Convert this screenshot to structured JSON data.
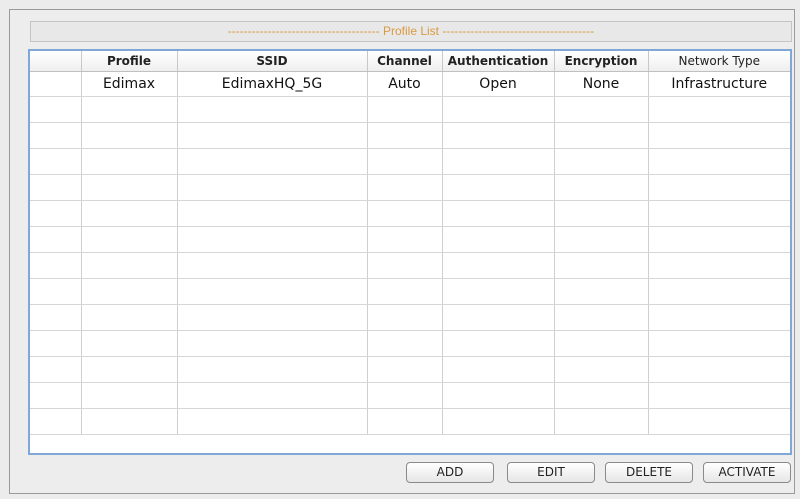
{
  "panel": {
    "title": "Profile List",
    "title_left_dashes": "--------------------------------------",
    "title_right_dashes": "--------------------------------------"
  },
  "table": {
    "columns": [
      "",
      "Profile",
      "SSID",
      "Channel",
      "Authentication",
      "Encryption",
      "Network Type"
    ],
    "rows": [
      [
        "",
        "Edimax",
        "EdimaxHQ_5G",
        "Auto",
        "Open",
        "None",
        "Infrastructure"
      ],
      [
        "",
        "",
        "",
        "",
        "",
        "",
        ""
      ],
      [
        "",
        "",
        "",
        "",
        "",
        "",
        ""
      ],
      [
        "",
        "",
        "",
        "",
        "",
        "",
        ""
      ],
      [
        "",
        "",
        "",
        "",
        "",
        "",
        ""
      ],
      [
        "",
        "",
        "",
        "",
        "",
        "",
        ""
      ],
      [
        "",
        "",
        "",
        "",
        "",
        "",
        ""
      ],
      [
        "",
        "",
        "",
        "",
        "",
        "",
        ""
      ],
      [
        "",
        "",
        "",
        "",
        "",
        "",
        ""
      ],
      [
        "",
        "",
        "",
        "",
        "",
        "",
        ""
      ],
      [
        "",
        "",
        "",
        "",
        "",
        "",
        ""
      ],
      [
        "",
        "",
        "",
        "",
        "",
        "",
        ""
      ],
      [
        "",
        "",
        "",
        "",
        "",
        "",
        ""
      ],
      [
        "",
        "",
        "",
        "",
        "",
        "",
        ""
      ]
    ]
  },
  "buttons": {
    "add": "ADD",
    "edit": "EDIT",
    "delete": "DELETE",
    "activate": "ACTIVATE"
  },
  "colors": {
    "title_text": "#d99a40",
    "table_border": "#7fa8d9"
  }
}
